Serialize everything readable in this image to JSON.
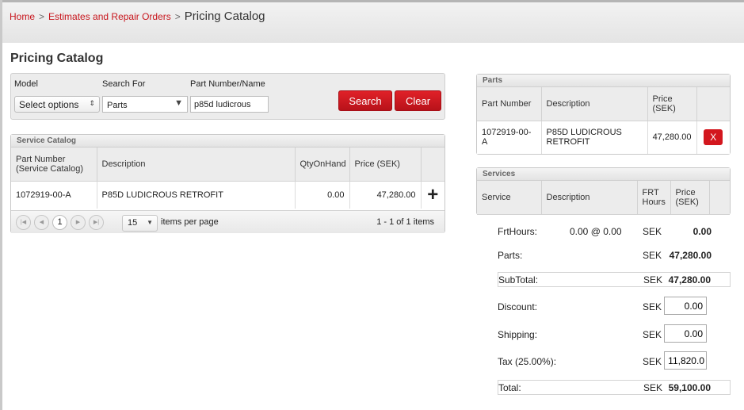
{
  "breadcrumb": {
    "home": "Home",
    "sep": ">",
    "estimates": "Estimates and Repair Orders",
    "current": "Pricing Catalog"
  },
  "page_title": "Pricing Catalog",
  "search": {
    "model_label": "Model",
    "model_value": "Select options",
    "search_for_label": "Search For",
    "search_for_value": "Parts",
    "part_label": "Part Number/Name",
    "part_value": "p85d ludicrous",
    "search_button": "Search",
    "clear_button": "Clear"
  },
  "service_catalog": {
    "title": "Service Catalog",
    "columns": [
      "Part Number\n(Service Catalog)",
      "Description",
      "QtyOnHand",
      "Price (SEK)"
    ],
    "rows": [
      {
        "part": "1072919-00-A",
        "description": "P85D LUDICROUS RETROFIT",
        "qty": "0.00",
        "price": "47,280.00",
        "add": "+"
      }
    ],
    "pager": {
      "page": "1",
      "page_size": "15",
      "items_per_page": "items per page",
      "summary": "1 - 1 of 1 items"
    }
  },
  "parts": {
    "title": "Parts",
    "columns": [
      "Part Number",
      "Description",
      "Price (SEK)"
    ],
    "rows": [
      {
        "part": "1072919-00-A",
        "description": "P85D LUDICROUS RETROFIT",
        "price": "47,280.00",
        "remove": "X"
      }
    ]
  },
  "services": {
    "title": "Services",
    "columns": [
      "Service",
      "Description",
      "FRT Hours",
      "Price (SEK)"
    ]
  },
  "totals": {
    "frt_label": "FrtHours:",
    "frt_mid": "0.00 @ 0.00",
    "frt_cur": "SEK",
    "frt_val": "0.00",
    "parts_label": "Parts:",
    "parts_cur": "SEK",
    "parts_val": "47,280.00",
    "subtotal_label": "SubTotal:",
    "subtotal_cur": "SEK",
    "subtotal_val": "47,280.00",
    "discount_label": "Discount:",
    "discount_cur": "SEK",
    "discount_val": "0.00",
    "shipping_label": "Shipping:",
    "shipping_cur": "SEK",
    "shipping_val": "0.00",
    "tax_label": "Tax (25.00%):",
    "tax_cur": "SEK",
    "tax_val": "11,820.0",
    "total_label": "Total:",
    "total_cur": "SEK",
    "total_val": "59,100.00"
  },
  "colors": {
    "accent": "#c8161d",
    "button": "#d3171e"
  },
  "icons": {
    "add": "plus-icon",
    "remove": "close-icon"
  }
}
